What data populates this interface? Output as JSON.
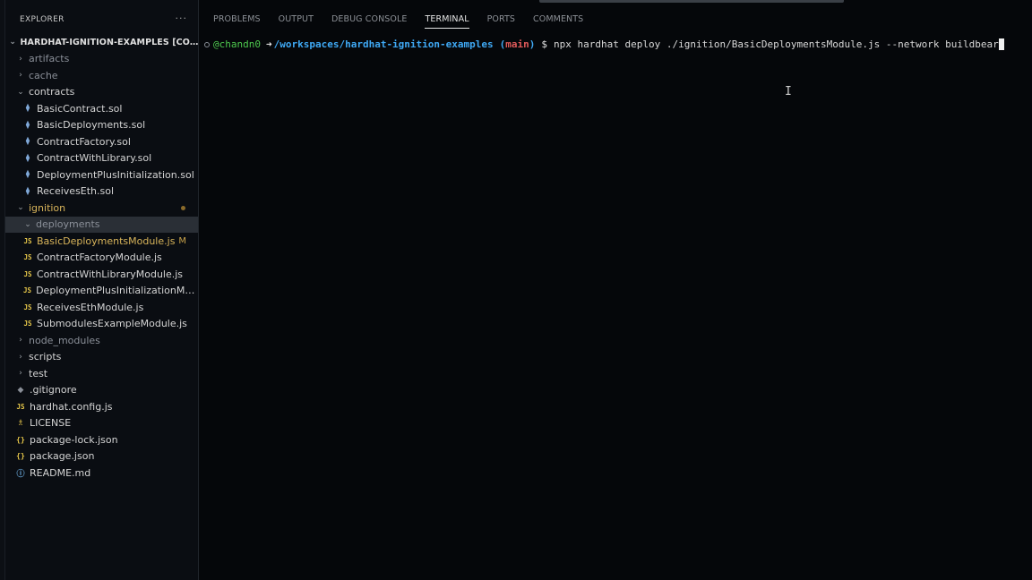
{
  "explorer": {
    "title": "EXPLORER",
    "more": "···",
    "root": "HARDHAT-IGNITION-EXAMPLES [CODESPA...",
    "items": [
      {
        "label": "artifacts",
        "kind": "folder",
        "open": false,
        "depth": 1,
        "dim": true
      },
      {
        "label": "cache",
        "kind": "folder",
        "open": false,
        "depth": 1,
        "dim": true
      },
      {
        "label": "contracts",
        "kind": "folder",
        "open": true,
        "depth": 1
      },
      {
        "label": "BasicContract.sol",
        "kind": "sol",
        "depth": 2
      },
      {
        "label": "BasicDeployments.sol",
        "kind": "sol",
        "depth": 2
      },
      {
        "label": "ContractFactory.sol",
        "kind": "sol",
        "depth": 2
      },
      {
        "label": "ContractWithLibrary.sol",
        "kind": "sol",
        "depth": 2
      },
      {
        "label": "DeploymentPlusInitialization.sol",
        "kind": "sol",
        "depth": 2
      },
      {
        "label": "ReceivesEth.sol",
        "kind": "sol",
        "depth": 2
      },
      {
        "label": "ignition",
        "kind": "folder",
        "open": true,
        "depth": 1,
        "modified_dot": true
      },
      {
        "label": "deployments",
        "kind": "folder",
        "open": true,
        "depth": 2,
        "selected": true,
        "dim": true
      },
      {
        "label": "BasicDeploymentsModule.js",
        "kind": "js",
        "depth": 2,
        "badge": "M"
      },
      {
        "label": "ContractFactoryModule.js",
        "kind": "js",
        "depth": 2
      },
      {
        "label": "ContractWithLibraryModule.js",
        "kind": "js",
        "depth": 2
      },
      {
        "label": "DeploymentPlusInitializationModul...",
        "kind": "js",
        "depth": 2
      },
      {
        "label": "ReceivesEthModule.js",
        "kind": "js",
        "depth": 2
      },
      {
        "label": "SubmodulesExampleModule.js",
        "kind": "js",
        "depth": 2
      },
      {
        "label": "node_modules",
        "kind": "folder",
        "open": false,
        "depth": 1,
        "dim": true
      },
      {
        "label": "scripts",
        "kind": "folder",
        "open": false,
        "depth": 1
      },
      {
        "label": "test",
        "kind": "folder",
        "open": false,
        "depth": 1
      },
      {
        "label": ".gitignore",
        "kind": "git",
        "depth": 1
      },
      {
        "label": "hardhat.config.js",
        "kind": "js",
        "depth": 1
      },
      {
        "label": "LICENSE",
        "kind": "license",
        "depth": 1
      },
      {
        "label": "package-lock.json",
        "kind": "json",
        "depth": 1
      },
      {
        "label": "package.json",
        "kind": "json",
        "depth": 1
      },
      {
        "label": "README.md",
        "kind": "info",
        "depth": 1
      }
    ]
  },
  "panel": {
    "tabs": [
      "PROBLEMS",
      "OUTPUT",
      "DEBUG CONSOLE",
      "TERMINAL",
      "PORTS",
      "COMMENTS"
    ],
    "active_tab": "TERMINAL"
  },
  "terminal": {
    "user": "@chandn0",
    "arrow": "➜",
    "path": "/workspaces/hardhat-ignition-examples",
    "git_open": "(",
    "branch": "main",
    "git_close": ")",
    "prompt": "$",
    "command": "npx hardhat deploy ./ignition/BasicDeploymentsModule.js --network buildbear"
  },
  "icons": {
    "js": "JS",
    "sol": "⧫",
    "json": "{}",
    "git": "◆",
    "license": "♗",
    "info": "ⓘ",
    "chev_open": "⌄",
    "chev_closed": "›",
    "ibeam": "I"
  }
}
